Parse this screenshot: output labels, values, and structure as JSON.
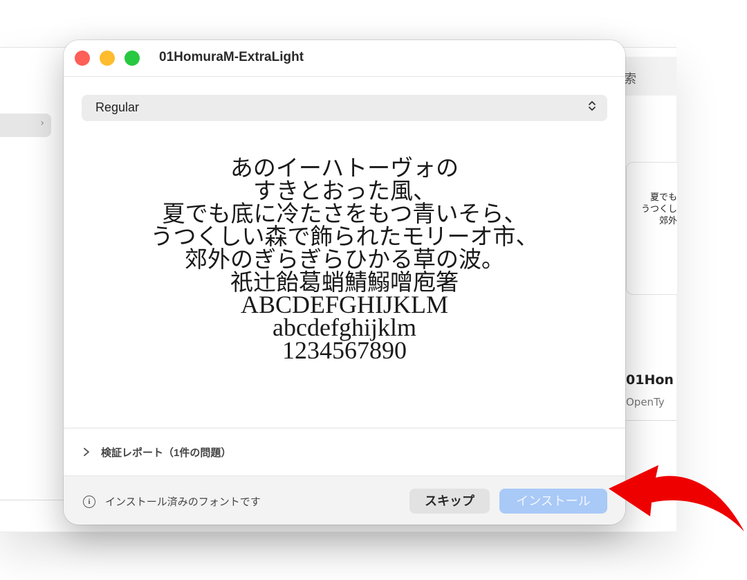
{
  "background": {
    "search_partial": "索",
    "sidebar_chevron": "›",
    "card_preview_lines": [
      "夏でも",
      "うつくし",
      "郊外"
    ],
    "font_name_partial": "01Hon",
    "font_type_partial": "OpenTy"
  },
  "dialog": {
    "title": "01HomuraM-ExtraLight",
    "style_select": {
      "value": "Regular",
      "icon": "chevron-up-down-icon"
    },
    "sample_lines": [
      "あのイーハトーヴォの",
      "すきとおった風、",
      "夏でも底に冷たさをもつ青いそら、",
      "うつくしい森で飾られたモリーオ市、",
      "郊外のぎらぎらひかる草の波。",
      "祇辻飴葛蛸鯖鰯噌庖箸",
      "ABCDEFGHIJKLM",
      "abcdefghijklm",
      "1234567890"
    ],
    "report_label": "検証レポート（1件の問題）",
    "info_text": "インストール済みのフォントです",
    "skip_label": "スキップ",
    "install_label": "インストール"
  },
  "colors": {
    "close": "#fe5f57",
    "minimize": "#febc2e",
    "zoom": "#28c840",
    "install_button": "#a9c9f7",
    "annotation_arrow": "#ee0000"
  }
}
